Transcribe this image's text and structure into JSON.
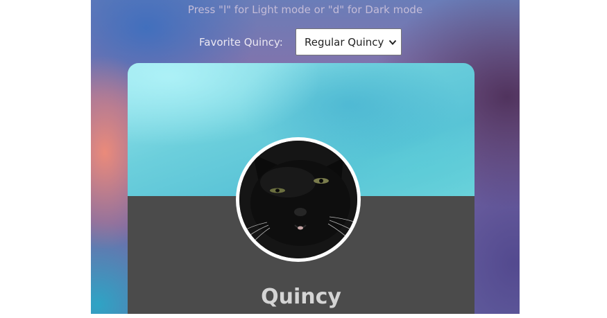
{
  "hint": "Press \"l\" for Light mode or \"d\" for Dark mode",
  "favorite": {
    "label": "Favorite Quincy:",
    "selected": "Regular Quincy"
  },
  "profile": {
    "name": "Quincy"
  },
  "icons": {
    "select_arrow": "chevron-down-icon"
  }
}
